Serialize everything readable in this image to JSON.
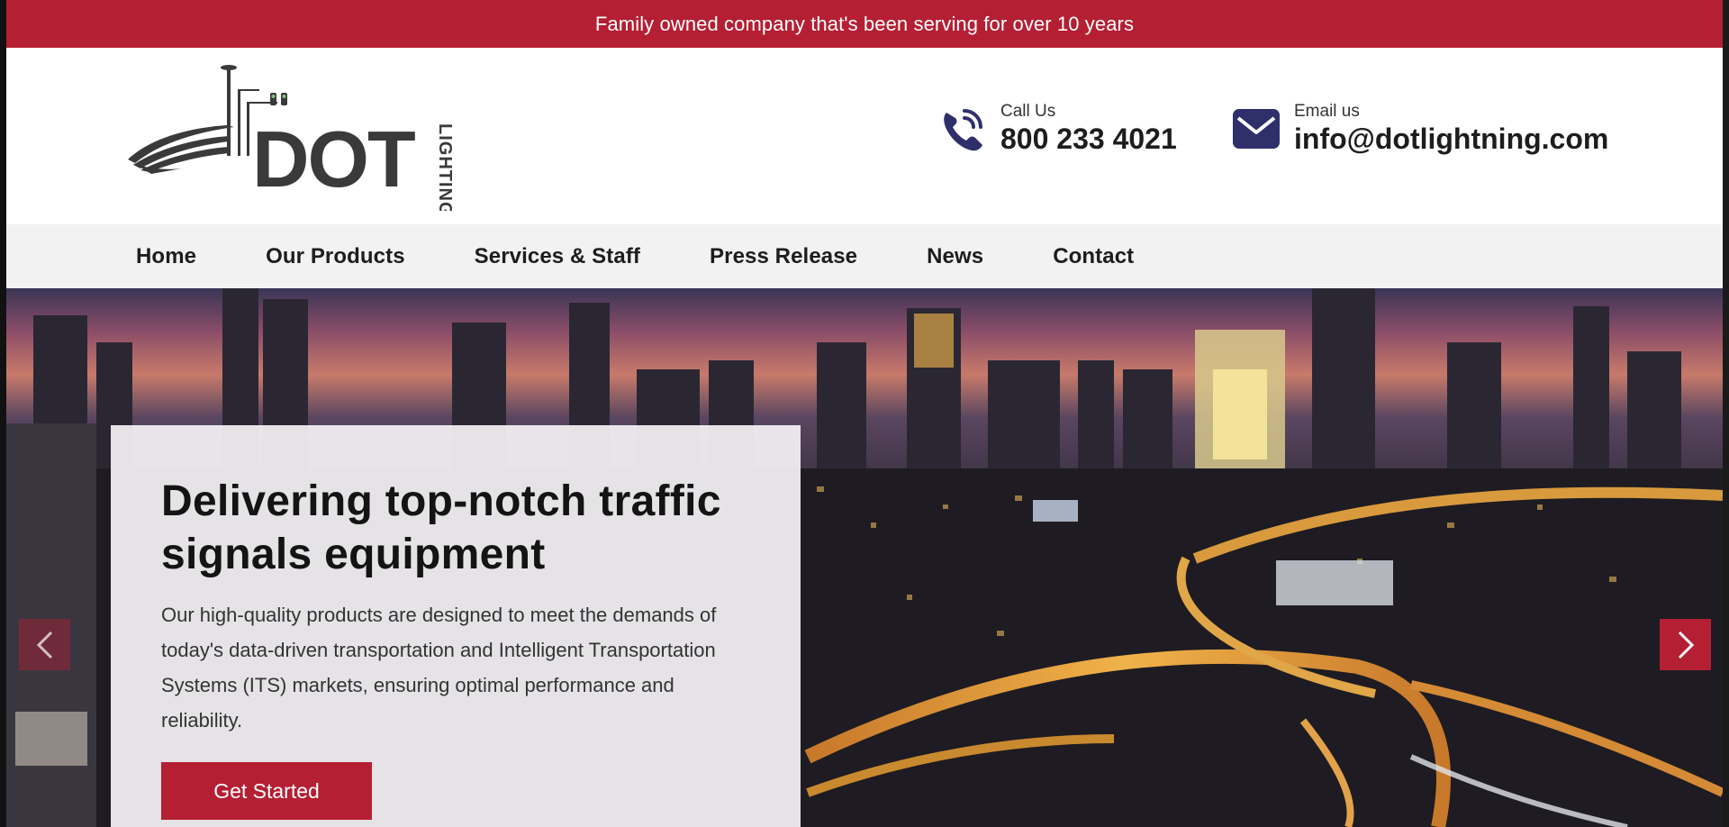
{
  "topbar": {
    "text": "Family owned company that's been serving for over 10 years"
  },
  "header": {
    "logo": {
      "brand": "DOT",
      "sub": "LIGHTING"
    },
    "call": {
      "label": "Call Us",
      "value": "800 233 4021",
      "icon": "phone-icon"
    },
    "email": {
      "label": "Email us",
      "value": "info@dotlightning.com",
      "icon": "envelope-icon"
    }
  },
  "nav": {
    "items": [
      {
        "label": "Home"
      },
      {
        "label": "Our Products"
      },
      {
        "label": "Services & Staff"
      },
      {
        "label": "Press Release"
      },
      {
        "label": "News"
      },
      {
        "label": "Contact"
      }
    ]
  },
  "hero": {
    "title": "Delivering top-notch traffic signals equipment",
    "body": "Our high-quality products are designed to meet the demands of today's data-driven transportation and Intelligent Transportation Systems (ITS) markets, ensuring optimal performance and reliability.",
    "cta": "Get Started",
    "prev_icon": "chevron-left-icon",
    "next_icon": "chevron-right-icon"
  },
  "colors": {
    "brand_red": "#b41f33",
    "icon_navy": "#2f2f6b",
    "nav_bg": "#f2f2f2"
  }
}
